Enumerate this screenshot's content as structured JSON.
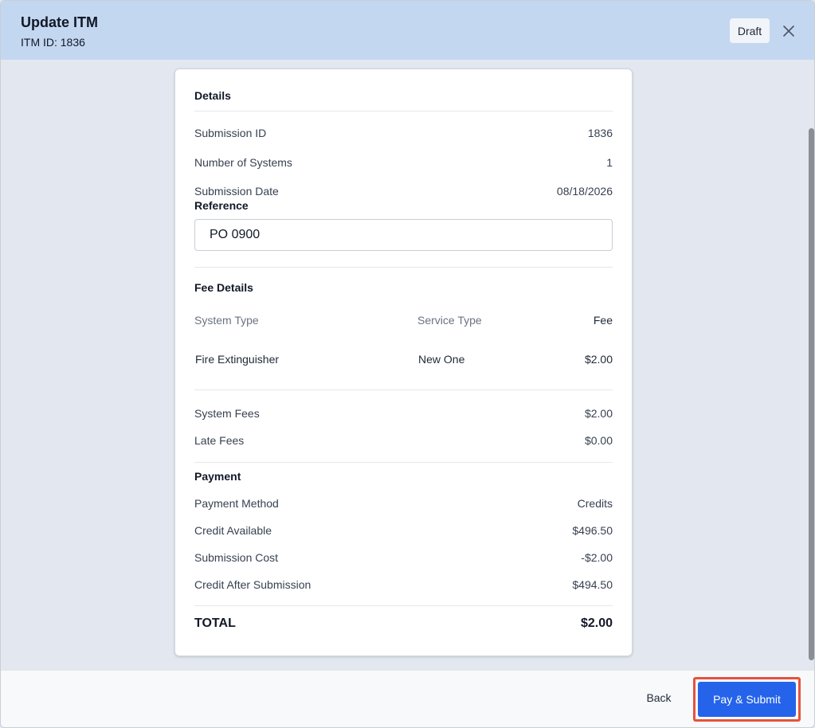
{
  "header": {
    "title": "Update ITM",
    "subtitle": "ITM ID: 1836",
    "badge": "Draft"
  },
  "details": {
    "title": "Details",
    "submission_id_label": "Submission ID",
    "submission_id_value": "1836",
    "num_systems_label": "Number of Systems",
    "num_systems_value": "1",
    "submission_date_label": "Submission Date",
    "submission_date_value": "08/18/2026",
    "reference_label": "Reference",
    "reference_value": "PO 0900"
  },
  "fees": {
    "title": "Fee Details",
    "col_system_type": "System Type",
    "col_service_type": "Service Type",
    "col_fee": "Fee",
    "rows": [
      {
        "system_type": "Fire Extinguisher",
        "service_type": "New One",
        "fee": "$2.00"
      }
    ],
    "system_fees_label": "System Fees",
    "system_fees_value": "$2.00",
    "late_fees_label": "Late Fees",
    "late_fees_value": "$0.00"
  },
  "payment": {
    "title": "Payment",
    "method_label": "Payment Method",
    "method_value": "Credits",
    "credit_available_label": "Credit Available",
    "credit_available_value": "$496.50",
    "submission_cost_label": "Submission Cost",
    "submission_cost_value": "-$2.00",
    "credit_after_label": "Credit After Submission",
    "credit_after_value": "$494.50",
    "total_label": "TOTAL",
    "total_value": "$2.00"
  },
  "footer": {
    "back_label": "Back",
    "submit_label": "Pay & Submit"
  },
  "colors": {
    "header_bg": "#c4d7f0",
    "primary": "#2563eb",
    "highlight": "#e5533d"
  }
}
